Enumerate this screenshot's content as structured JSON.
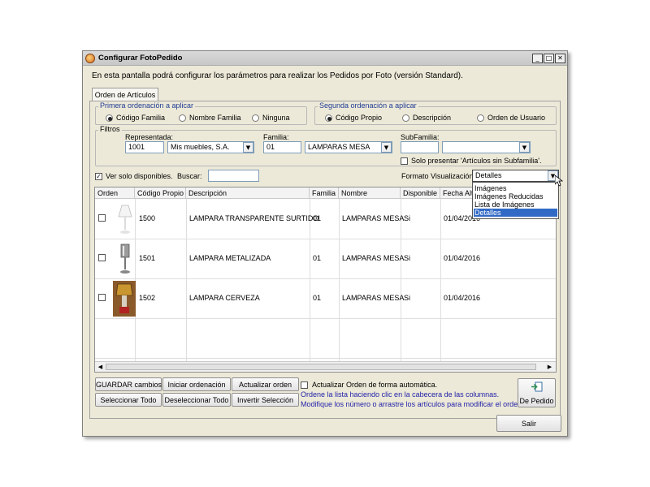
{
  "window": {
    "title": "Configurar FotoPedido",
    "btn_min": "_",
    "btn_max": "□",
    "btn_close": "✕"
  },
  "description": "En esta pantalla podrá configurar los parámetros para realizar los Pedidos por Foto (versión Standard).",
  "tab": {
    "label": "Orden de Artículos"
  },
  "primera": {
    "legend": "Primera ordenación a aplicar",
    "options": [
      "Código Familia",
      "Nombre Familia",
      "Ninguna"
    ],
    "selected": 0
  },
  "segunda": {
    "legend": "Segunda ordenación a aplicar",
    "options": [
      "Código Propio",
      "Descripción",
      "Orden de Usuario"
    ],
    "selected": 0
  },
  "filtros": {
    "legend": "Filtros",
    "representada_label": "Representada:",
    "representada_code": "1001",
    "representada_name": "Mis muebles, S.A.",
    "familia_label": "Familia:",
    "familia_code": "01",
    "familia_name": "LAMPARAS MESA",
    "subfamilia_label": "SubFamilia:",
    "subfamilia_code": "",
    "subfamilia_name": "",
    "solo_sin_subfamilia": "Solo presentar 'Artículos sin Subfamilia'."
  },
  "ver_solo_disponibles": "Ver solo disponibles.",
  "buscar_label": "Buscar:",
  "buscar_value": "",
  "formato": {
    "label": "Formato Visualización:",
    "value": "Detalles",
    "options": [
      "Imágenes",
      "Imágenes Reducidas",
      "Lista de Imágenes",
      "Detalles"
    ]
  },
  "table": {
    "columns": [
      "Orden",
      "Código Propio",
      "Descripción",
      "Familia",
      "Nombre",
      "Disponible",
      "Fecha Alt"
    ],
    "rows": [
      {
        "codigo": "1500",
        "descripcion": "LAMPARA TRANSPARENTE SURTIDO",
        "familia": "01",
        "nombre": "LAMPARAS MESA",
        "disponible": "Si",
        "fecha": "01/04/2016"
      },
      {
        "codigo": "1501",
        "descripcion": "LAMPARA METALIZADA",
        "familia": "01",
        "nombre": "LAMPARAS MESA",
        "disponible": "Si",
        "fecha": "01/04/2016"
      },
      {
        "codigo": "1502",
        "descripcion": "LAMPARA CERVEZA",
        "familia": "01",
        "nombre": "LAMPARAS MESA",
        "disponible": "Si",
        "fecha": "01/04/2016"
      }
    ]
  },
  "buttons": {
    "guardar": "GUARDAR cambios",
    "iniciar": "Iniciar ordenación",
    "actualizar": "Actualizar orden",
    "seleccionar": "Seleccionar Todo",
    "deseleccionar": "Deseleccionar Todo",
    "invertir": "Invertir Selección",
    "de_pedido": "De Pedido",
    "salir": "Salir"
  },
  "auto_update": "Actualizar Orden de forma automática.",
  "hint1": "Ordene la lista haciendo clic en la cabecera de las columnas.",
  "hint2": "Modifique los número o arrastre los artículos para modificar el orden.",
  "colors": {
    "accent": "#316ac5",
    "hint": "#1f1fa8",
    "legend": "#1f3a93"
  }
}
